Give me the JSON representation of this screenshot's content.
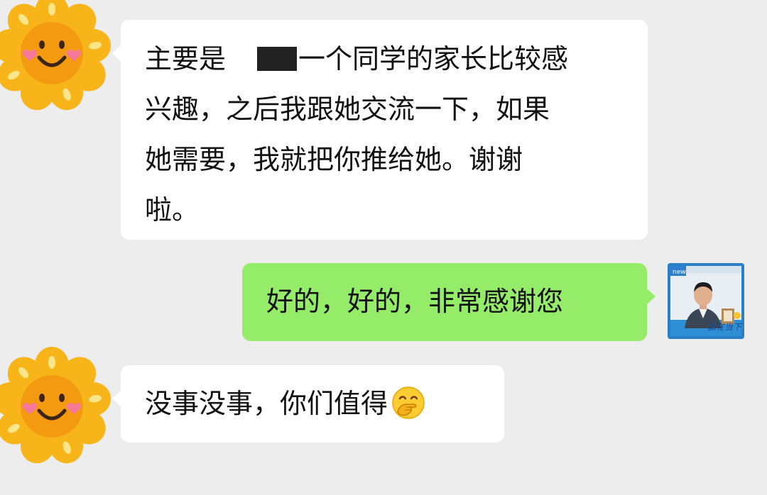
{
  "chat": {
    "messages": [
      {
        "side": "left",
        "lines": [
          "主要是",
          "一个同学的家长比较感",
          "兴趣，之后我跟她交流一下，如果",
          "她需要，我就把你推给她。谢谢",
          "啦。"
        ],
        "has_redaction": true
      },
      {
        "side": "right",
        "text": "好的，好的，非常感谢您"
      },
      {
        "side": "left",
        "text": "没事没事，你们值得",
        "emoji": "hand-over-mouth-emoji"
      }
    ],
    "contact_avatar": "sunflower-icon",
    "self_avatar": {
      "badge": "new",
      "sign_text": "赢在当下"
    },
    "colors": {
      "background": "#ededed",
      "left_bubble": "#ffffff",
      "right_bubble": "#95ec69"
    }
  }
}
